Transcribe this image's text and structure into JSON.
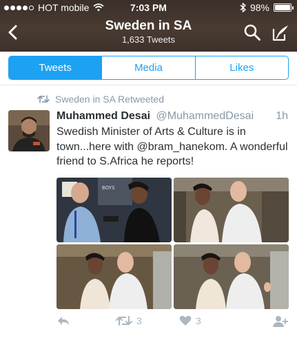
{
  "status_bar": {
    "carrier": "HOT mobile",
    "time": "7:03 PM",
    "battery_percent": "98%",
    "battery_level": 0.98
  },
  "nav": {
    "title": "Sweden in SA",
    "subtitle": "1,633 Tweets"
  },
  "tabs": [
    {
      "label": "Tweets",
      "active": true
    },
    {
      "label": "Media",
      "active": false
    },
    {
      "label": "Likes",
      "active": false
    }
  ],
  "tweet": {
    "retweet_label": "Sweden in SA Retweeted",
    "author_name": "Muhammed Desai",
    "author_handle": "@MuhammedDesai",
    "age": "1h",
    "text": "Swedish Minister of Arts & Culture is in town...here with @bram_hanekom. A wonderful friend to S.Africa he reports!",
    "photo_sign_text": "BOYS",
    "retweet_count": "3",
    "like_count": "3"
  },
  "colors": {
    "accent": "#1da1f2",
    "header_bg": "#3a2f29",
    "muted": "#8899a6",
    "action_icon": "#aab8c2"
  }
}
